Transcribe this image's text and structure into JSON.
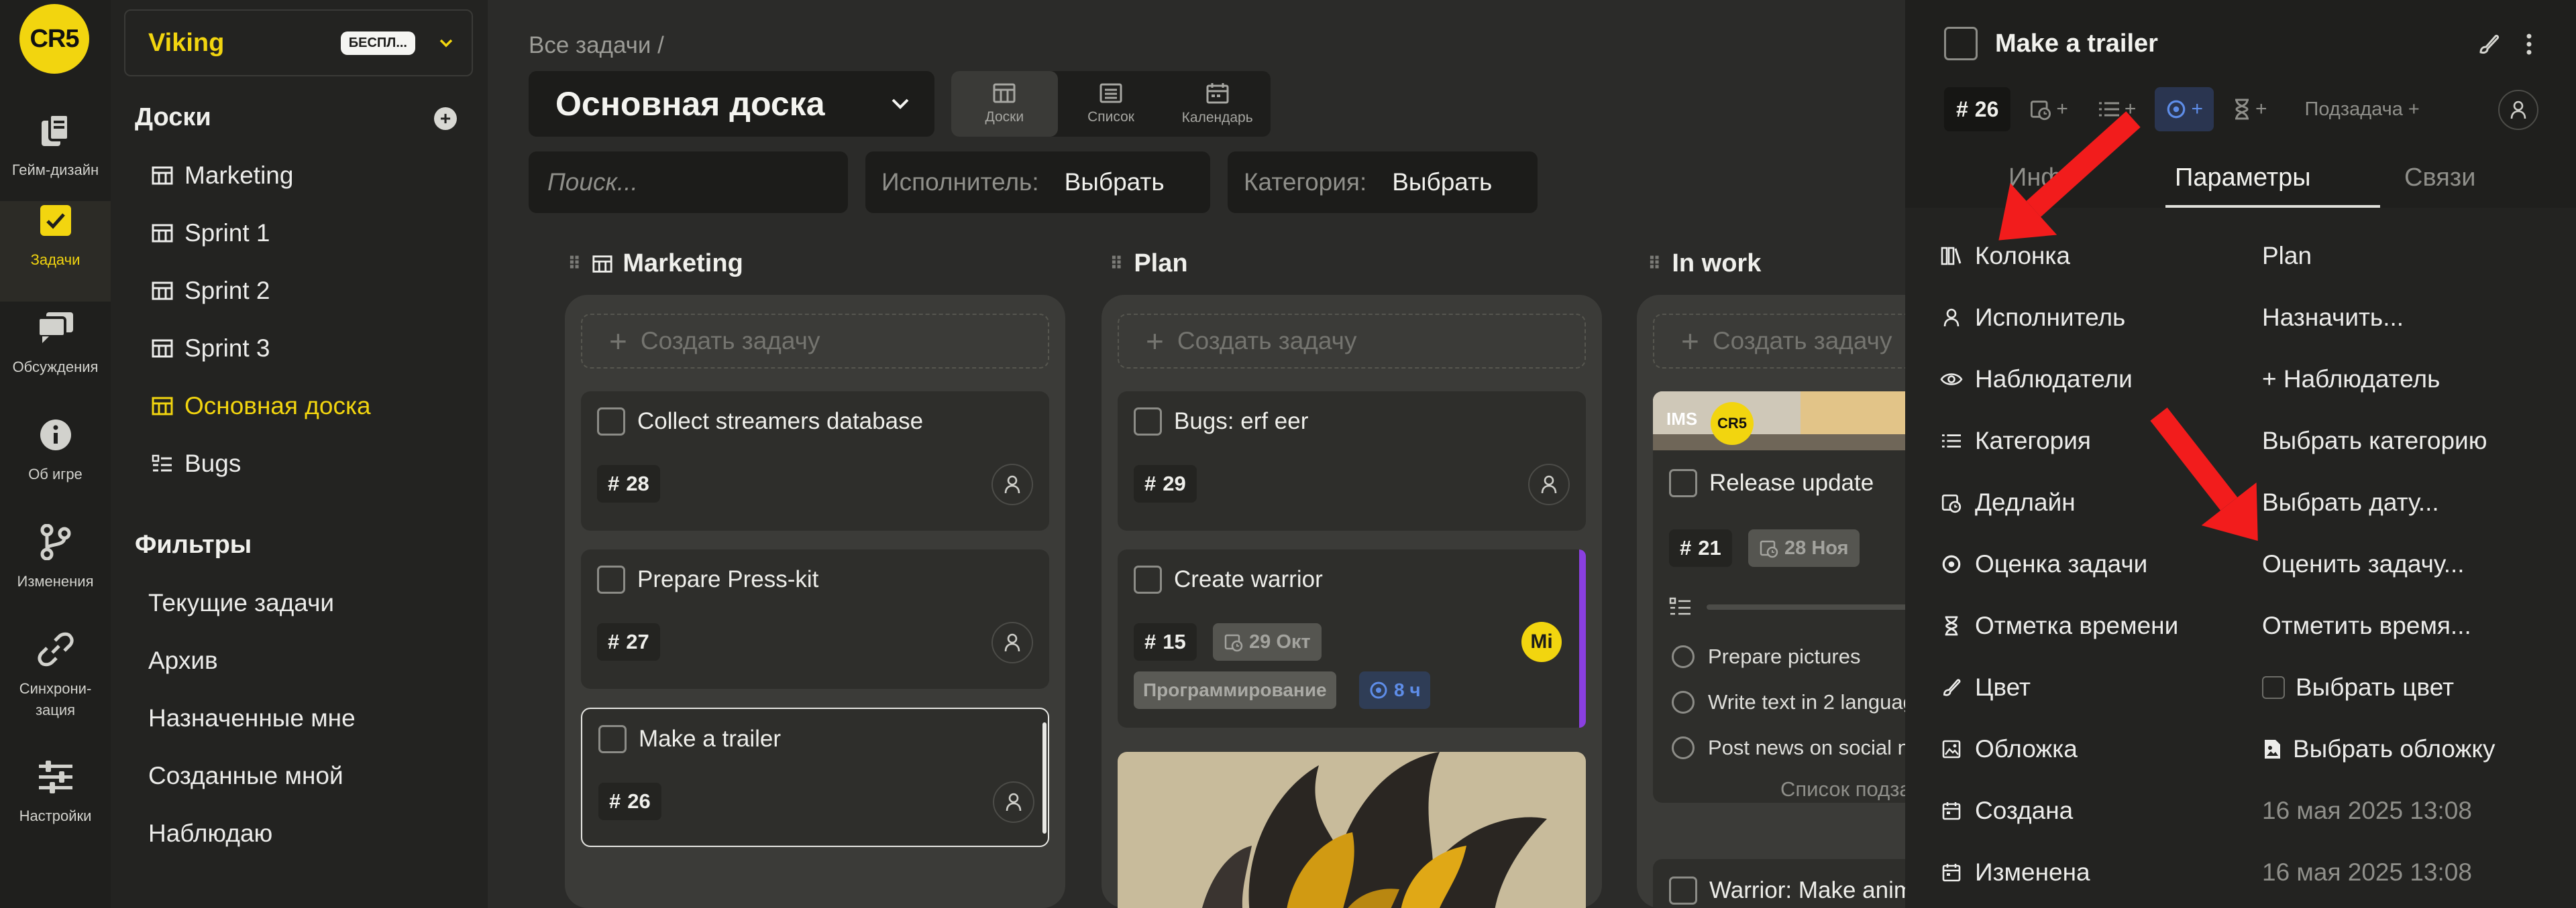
{
  "rail": {
    "logo": "CR5",
    "items": [
      {
        "label": "Гейм-дизайн",
        "icon": "cards-icon"
      },
      {
        "label": "Задачи",
        "icon": "checkbox-icon"
      },
      {
        "label": "Обсуждения",
        "icon": "chat-icon"
      },
      {
        "label": "Об игре",
        "icon": "info-icon"
      },
      {
        "label": "Изменения",
        "icon": "git-branch-icon"
      },
      {
        "label": "Синхрони-\nзация",
        "icon": "link-icon"
      },
      {
        "label": "Настройки",
        "icon": "sliders-icon"
      }
    ]
  },
  "sidebar": {
    "workspace_name": "Viking",
    "workspace_badge": "БЕСПЛ...",
    "boards_title": "Доски",
    "boards": [
      "Marketing",
      "Sprint 1",
      "Sprint 2",
      "Sprint 3",
      "Основная доска",
      "Bugs"
    ],
    "filters_title": "Фильтры",
    "filters": [
      "Текущие задачи",
      "Архив",
      "Назначенные мне",
      "Созданные мной",
      "Наблюдаю"
    ]
  },
  "header": {
    "breadcrumb": "Все задачи /",
    "board_title": "Основная доска",
    "views": [
      "Доски",
      "Список",
      "Календарь"
    ],
    "search_placeholder": "Поиск...",
    "assignee_label": "Исполнитель:",
    "assignee_value": "Выбрать",
    "category_label": "Категория:",
    "category_value": "Выбрать"
  },
  "columns": [
    {
      "name": "Marketing",
      "create_label": "Создать задачу",
      "cards": [
        {
          "title": "Collect streamers database",
          "number": "28"
        },
        {
          "title": "Prepare Press-kit",
          "number": "27"
        },
        {
          "title": "Make a trailer",
          "number": "26"
        }
      ]
    },
    {
      "name": "Plan",
      "create_label": "Создать задачу",
      "cards": [
        {
          "title": "Bugs: erf eer",
          "number": "29"
        },
        {
          "title": "Create warrior",
          "number": "15",
          "date": "29 Окт",
          "tag": "Программирование",
          "estimate": "8 ч",
          "assignee_initials": "Mi"
        }
      ]
    },
    {
      "name": "In work",
      "create_label": "Создать задачу",
      "cover_text": "IMS",
      "cover_logo": "CR5",
      "cards": [
        {
          "title": "Release update",
          "number": "21",
          "date": "28 Ноя",
          "subtasks": [
            "Prepare pictures",
            "Write text in 2 languag",
            "Post news on social ne"
          ],
          "subtasks_footer": "Список подза"
        },
        {
          "title": "Warrior: Make anim"
        }
      ]
    }
  ],
  "panel": {
    "title": "Make a trailer",
    "number": "26",
    "subtask_btn": "Подзадача +",
    "tabs": [
      "Инфо",
      "Параметры",
      "Связи"
    ],
    "properties": [
      {
        "key": "Колонка",
        "value": "Plan",
        "icon": "columns-icon"
      },
      {
        "key": "Исполнитель",
        "value": "Назначить...",
        "icon": "user-icon"
      },
      {
        "key": "Наблюдатели",
        "value": "+ Наблюдатель",
        "icon": "eye-icon"
      },
      {
        "key": "Категория",
        "value": "Выбрать категорию",
        "icon": "list-icon"
      },
      {
        "key": "Дедлайн",
        "value": "Выбрать дату...",
        "icon": "calendar-clock-icon"
      },
      {
        "key": "Оценка задачи",
        "value": "Оценить задачу...",
        "icon": "estimate-icon"
      },
      {
        "key": "Отметка времени",
        "value": "Отметить время...",
        "icon": "hourglass-icon"
      },
      {
        "key": "Цвет",
        "value": "Выбрать цвет",
        "icon": "brush-icon"
      },
      {
        "key": "Обложка",
        "value": "Выбрать обложку",
        "icon": "image-icon"
      },
      {
        "key": "Создана",
        "value": "16 мая 2025 13:08",
        "icon": "calendar-icon"
      },
      {
        "key": "Изменена",
        "value": "16 мая 2025 13:08",
        "icon": "calendar-icon"
      }
    ]
  },
  "colors": {
    "accent": "#f2d50f",
    "estimate_blue": "#5e8de8",
    "card_purple": "#8a3fe0",
    "annotation_red": "#f21c1c"
  }
}
